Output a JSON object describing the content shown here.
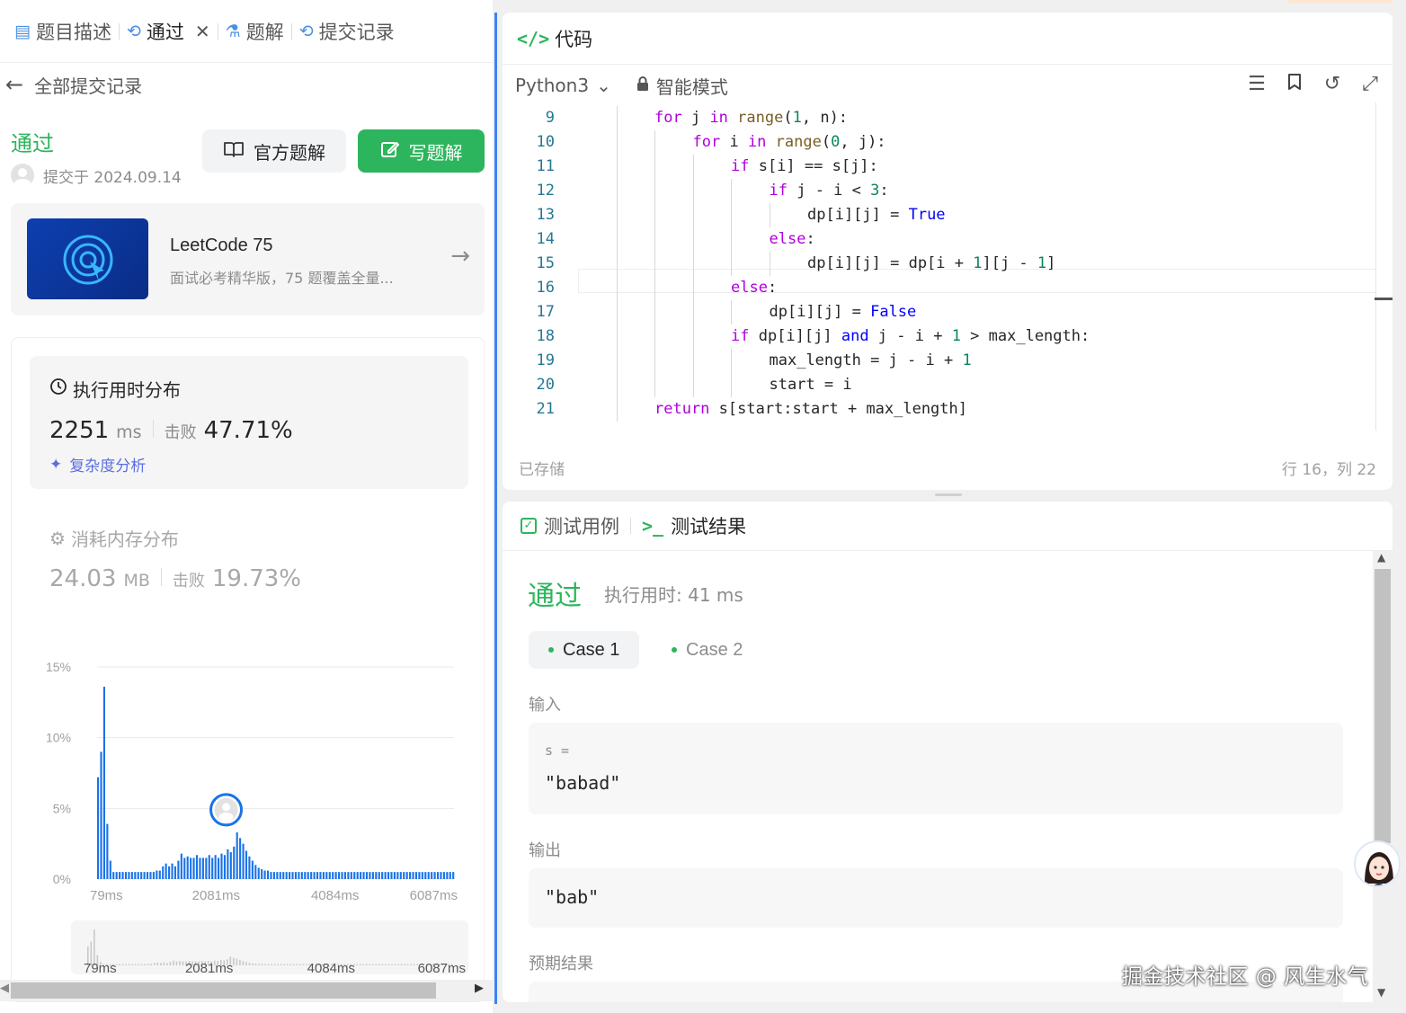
{
  "left_tabs": {
    "description": "题目描述",
    "accepted": "通过",
    "solutions": "题解",
    "submissions": "提交记录"
  },
  "back_label": "全部提交记录",
  "submission": {
    "status": "通过",
    "submitted_at": "提交于 2024.09.14",
    "official_solution_button": "官方题解",
    "write_solution_button": "写题解"
  },
  "promo": {
    "title": "LeetCode 75",
    "subtitle": "面试必考精华版，75 题覆盖全量..."
  },
  "runtime": {
    "title": "执行用时分布",
    "value": "2251",
    "unit": "ms",
    "beat_label": "击败",
    "beat_pct": "47.71%",
    "complexity_link": "复杂度分析"
  },
  "memory": {
    "title": "消耗内存分布",
    "value": "24.03",
    "unit": "MB",
    "beat_label": "击败",
    "beat_pct": "19.73%"
  },
  "chart_data": {
    "type": "bar",
    "y_ticks": [
      "15%",
      "10%",
      "5%",
      "0%"
    ],
    "ylim": [
      0,
      15
    ],
    "x_ticks": [
      "79ms",
      "2081ms",
      "4084ms",
      "6087ms"
    ],
    "xlim": [
      79,
      6087
    ],
    "user_marker_x": 2251,
    "bars": [
      {
        "x": 79,
        "y": 7.2
      },
      {
        "x": 131,
        "y": 9.0
      },
      {
        "x": 183,
        "y": 13.6
      },
      {
        "x": 235,
        "y": 3.9
      },
      {
        "x": 287,
        "y": 1.3
      },
      {
        "x": 339,
        "y": 0.5
      },
      {
        "x": 391,
        "y": 0.5
      },
      {
        "x": 443,
        "y": 0.5
      },
      {
        "x": 495,
        "y": 0.5
      },
      {
        "x": 547,
        "y": 0.5
      },
      {
        "x": 599,
        "y": 0.5
      },
      {
        "x": 651,
        "y": 0.5
      },
      {
        "x": 703,
        "y": 0.5
      },
      {
        "x": 755,
        "y": 0.5
      },
      {
        "x": 807,
        "y": 0.5
      },
      {
        "x": 859,
        "y": 0.5
      },
      {
        "x": 911,
        "y": 0.5
      },
      {
        "x": 963,
        "y": 0.5
      },
      {
        "x": 1015,
        "y": 0.5
      },
      {
        "x": 1067,
        "y": 0.6
      },
      {
        "x": 1119,
        "y": 0.6
      },
      {
        "x": 1171,
        "y": 0.9
      },
      {
        "x": 1223,
        "y": 1.1
      },
      {
        "x": 1275,
        "y": 0.9
      },
      {
        "x": 1327,
        "y": 1.1
      },
      {
        "x": 1379,
        "y": 0.9
      },
      {
        "x": 1431,
        "y": 1.3
      },
      {
        "x": 1483,
        "y": 1.8
      },
      {
        "x": 1535,
        "y": 1.5
      },
      {
        "x": 1587,
        "y": 1.6
      },
      {
        "x": 1639,
        "y": 1.5
      },
      {
        "x": 1691,
        "y": 1.5
      },
      {
        "x": 1743,
        "y": 1.7
      },
      {
        "x": 1795,
        "y": 1.5
      },
      {
        "x": 1847,
        "y": 1.5
      },
      {
        "x": 1899,
        "y": 1.5
      },
      {
        "x": 1951,
        "y": 1.7
      },
      {
        "x": 2003,
        "y": 1.5
      },
      {
        "x": 2055,
        "y": 1.7
      },
      {
        "x": 2107,
        "y": 1.5
      },
      {
        "x": 2159,
        "y": 1.8
      },
      {
        "x": 2211,
        "y": 1.7
      },
      {
        "x": 2263,
        "y": 2.1
      },
      {
        "x": 2315,
        "y": 1.9
      },
      {
        "x": 2367,
        "y": 2.3
      },
      {
        "x": 2419,
        "y": 3.3
      },
      {
        "x": 2471,
        "y": 2.9
      },
      {
        "x": 2523,
        "y": 2.5
      },
      {
        "x": 2575,
        "y": 2.0
      },
      {
        "x": 2627,
        "y": 1.6
      },
      {
        "x": 2679,
        "y": 1.3
      },
      {
        "x": 2731,
        "y": 1.0
      },
      {
        "x": 2783,
        "y": 0.8
      },
      {
        "x": 2835,
        "y": 0.7
      },
      {
        "x": 2887,
        "y": 0.6
      },
      {
        "x": 2939,
        "y": 0.6
      },
      {
        "x": 2991,
        "y": 0.5
      },
      {
        "x": 3043,
        "y": 0.5
      },
      {
        "x": 3095,
        "y": 0.5
      },
      {
        "x": 3147,
        "y": 0.5
      },
      {
        "x": 3199,
        "y": 0.5
      },
      {
        "x": 3251,
        "y": 0.5
      },
      {
        "x": 3303,
        "y": 0.5
      },
      {
        "x": 3355,
        "y": 0.5
      },
      {
        "x": 3407,
        "y": 0.5
      },
      {
        "x": 3459,
        "y": 0.5
      },
      {
        "x": 3511,
        "y": 0.5
      },
      {
        "x": 3563,
        "y": 0.5
      },
      {
        "x": 3615,
        "y": 0.5
      },
      {
        "x": 3667,
        "y": 0.5
      },
      {
        "x": 3719,
        "y": 0.5
      },
      {
        "x": 3771,
        "y": 0.5
      },
      {
        "x": 3823,
        "y": 0.5
      },
      {
        "x": 3875,
        "y": 0.5
      },
      {
        "x": 3927,
        "y": 0.5
      },
      {
        "x": 3979,
        "y": 0.5
      },
      {
        "x": 4031,
        "y": 0.5
      },
      {
        "x": 4083,
        "y": 0.5
      },
      {
        "x": 4135,
        "y": 0.5
      },
      {
        "x": 4187,
        "y": 0.5
      },
      {
        "x": 4239,
        "y": 0.5
      },
      {
        "x": 4291,
        "y": 0.5
      },
      {
        "x": 4343,
        "y": 0.5
      },
      {
        "x": 4395,
        "y": 0.5
      },
      {
        "x": 4447,
        "y": 0.5
      },
      {
        "x": 4499,
        "y": 0.5
      },
      {
        "x": 4551,
        "y": 0.5
      },
      {
        "x": 4603,
        "y": 0.5
      },
      {
        "x": 4655,
        "y": 0.5
      },
      {
        "x": 4707,
        "y": 0.5
      },
      {
        "x": 4759,
        "y": 0.5
      },
      {
        "x": 4811,
        "y": 0.5
      },
      {
        "x": 4863,
        "y": 0.5
      },
      {
        "x": 4915,
        "y": 0.5
      },
      {
        "x": 4967,
        "y": 0.5
      },
      {
        "x": 5019,
        "y": 0.5
      },
      {
        "x": 5071,
        "y": 0.5
      },
      {
        "x": 5123,
        "y": 0.5
      },
      {
        "x": 5175,
        "y": 0.5
      },
      {
        "x": 5227,
        "y": 0.5
      },
      {
        "x": 5279,
        "y": 0.5
      },
      {
        "x": 5331,
        "y": 0.5
      },
      {
        "x": 5383,
        "y": 0.5
      },
      {
        "x": 5435,
        "y": 0.5
      },
      {
        "x": 5487,
        "y": 0.5
      },
      {
        "x": 5539,
        "y": 0.5
      },
      {
        "x": 5591,
        "y": 0.5
      },
      {
        "x": 5643,
        "y": 0.5
      },
      {
        "x": 5695,
        "y": 0.5
      },
      {
        "x": 5747,
        "y": 0.5
      },
      {
        "x": 5799,
        "y": 0.5
      },
      {
        "x": 5851,
        "y": 0.5
      },
      {
        "x": 5903,
        "y": 0.5
      },
      {
        "x": 5955,
        "y": 0.5
      },
      {
        "x": 6007,
        "y": 0.5
      },
      {
        "x": 6059,
        "y": 0.5
      }
    ],
    "bar_color": "#1a73e8",
    "grid": true
  },
  "mini_chart": {
    "x_ticks": [
      "79ms",
      "2081ms",
      "4084ms",
      "6087ms"
    ]
  },
  "code_panel": {
    "title": "代码",
    "language": "Python3",
    "mode": "智能模式",
    "saved": "已存储",
    "cursor": "行 16，列 22",
    "lines": [
      {
        "n": "9",
        "indent": 2,
        "tokens": [
          [
            "kw",
            "for"
          ],
          [
            "t",
            " j "
          ],
          [
            "kw",
            "in"
          ],
          [
            "t",
            " "
          ],
          [
            "fn",
            "range"
          ],
          [
            "t",
            "("
          ],
          [
            "num",
            "1"
          ],
          [
            "t",
            ", n):"
          ]
        ]
      },
      {
        "n": "10",
        "indent": 3,
        "tokens": [
          [
            "kw",
            "for"
          ],
          [
            "t",
            " i "
          ],
          [
            "kw",
            "in"
          ],
          [
            "t",
            " "
          ],
          [
            "fn",
            "range"
          ],
          [
            "t",
            "("
          ],
          [
            "num",
            "0"
          ],
          [
            "t",
            ", j):"
          ]
        ]
      },
      {
        "n": "11",
        "indent": 4,
        "tokens": [
          [
            "kw",
            "if"
          ],
          [
            "t",
            " s[i] == s[j]:"
          ]
        ]
      },
      {
        "n": "12",
        "indent": 5,
        "tokens": [
          [
            "kw",
            "if"
          ],
          [
            "t",
            " j - i < "
          ],
          [
            "num",
            "3"
          ],
          [
            "t",
            ":"
          ]
        ]
      },
      {
        "n": "13",
        "indent": 6,
        "tokens": [
          [
            "t",
            "dp[i][j] = "
          ],
          [
            "bool",
            "True"
          ]
        ]
      },
      {
        "n": "14",
        "indent": 5,
        "tokens": [
          [
            "kw",
            "else"
          ],
          [
            "t",
            ":"
          ]
        ]
      },
      {
        "n": "15",
        "indent": 6,
        "tokens": [
          [
            "t",
            "dp[i][j] = dp[i + "
          ],
          [
            "num",
            "1"
          ],
          [
            "t",
            "][j - "
          ],
          [
            "num",
            "1"
          ],
          [
            "t",
            "]"
          ]
        ]
      },
      {
        "n": "16",
        "indent": 4,
        "tokens": [
          [
            "kw",
            "else"
          ],
          [
            "t",
            ":"
          ]
        ]
      },
      {
        "n": "17",
        "indent": 5,
        "tokens": [
          [
            "t",
            "dp[i][j] = "
          ],
          [
            "bool",
            "False"
          ]
        ]
      },
      {
        "n": "18",
        "indent": 4,
        "tokens": [
          [
            "kw",
            "if"
          ],
          [
            "t",
            " dp[i][j] "
          ],
          [
            "bool",
            "and"
          ],
          [
            "t",
            " j - i + "
          ],
          [
            "num",
            "1"
          ],
          [
            "t",
            " > max_length:"
          ]
        ]
      },
      {
        "n": "19",
        "indent": 5,
        "tokens": [
          [
            "t",
            "max_length = j - i + "
          ],
          [
            "num",
            "1"
          ]
        ]
      },
      {
        "n": "20",
        "indent": 5,
        "tokens": [
          [
            "t",
            "start = i"
          ]
        ]
      },
      {
        "n": "21",
        "indent": 2,
        "tokens": [
          [
            "kw",
            "return"
          ],
          [
            "t",
            " s[start:start + max_length]"
          ]
        ]
      }
    ]
  },
  "result_panel": {
    "tab_testcase": "测试用例",
    "tab_result": "测试结果",
    "status": "通过",
    "runtime": "执行用时: 41 ms",
    "case1": "Case 1",
    "case2": "Case 2",
    "input_label": "输入",
    "input_var": "s =",
    "input_value": "\"babad\"",
    "output_label": "输出",
    "output_value": "\"bab\"",
    "expected_label": "预期结果"
  },
  "watermark": "掘金技术社区 @ 风生水气",
  "colors": {
    "accent_green": "#2db55d",
    "accent_blue": "#3b82f6",
    "link_purple": "#5b6ee1"
  }
}
